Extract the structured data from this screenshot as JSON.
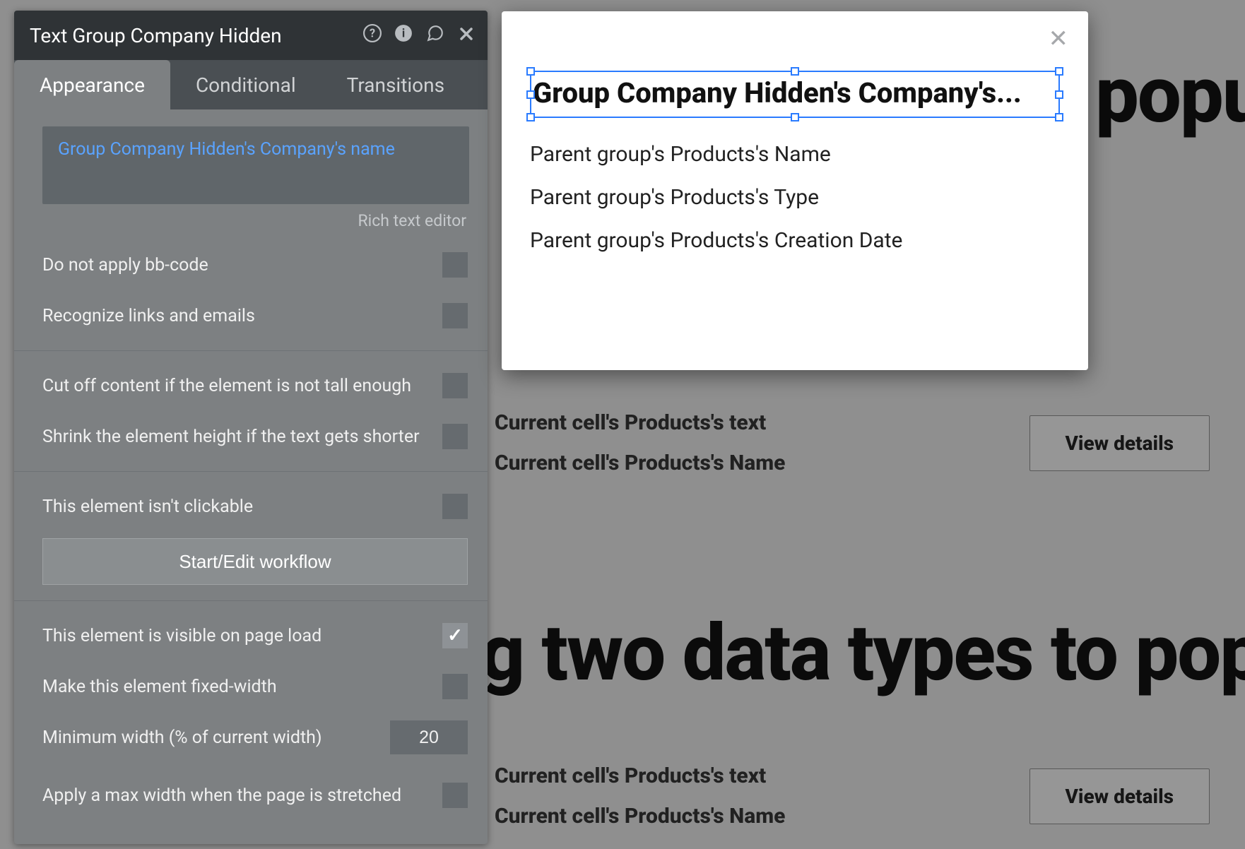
{
  "inspector": {
    "title": "Text Group Company Hidden",
    "tabs": {
      "appearance": "Appearance",
      "conditional": "Conditional",
      "transitions": "Transitions"
    },
    "expression": "Group Company Hidden's Company's name",
    "rich_text_link": "Rich text editor",
    "options": {
      "no_bbcode": "Do not apply bb-code",
      "recognize_links": "Recognize links and emails",
      "cut_off": "Cut off content if the element is not tall enough",
      "shrink": "Shrink the element height if the text gets shorter",
      "not_clickable": "This element isn't clickable",
      "workflow_btn": "Start/Edit workflow",
      "visible_on_load": "This element is visible on page load",
      "fixed_width": "Make this element fixed-width",
      "min_width_label": "Minimum width (% of current width)",
      "min_width_value": "20",
      "max_width": "Apply a max width when the page is stretched"
    }
  },
  "popup": {
    "heading": "Group Company Hidden's Company's...",
    "lines": {
      "l1": "Parent group's Products's Name",
      "l2": "Parent group's Products's Type",
      "l3": "Parent group's Products's Creation Date"
    }
  },
  "canvas": {
    "heading1": "popu",
    "heading2": "g two data types to pop",
    "cell_text": "Current cell's Products's text",
    "cell_name": "Current cell's Products's Name",
    "view_btn": "View details"
  }
}
